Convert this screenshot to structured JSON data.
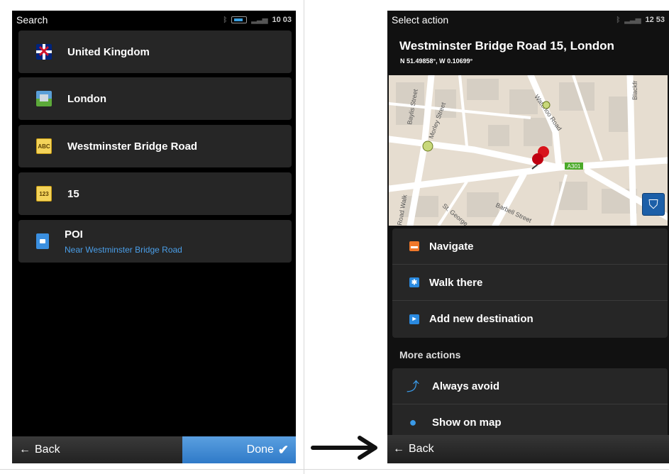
{
  "left_screen": {
    "status": {
      "title": "Search",
      "time": "10 03"
    },
    "items": [
      {
        "icon": "uk-flag-icon",
        "label": "United Kingdom"
      },
      {
        "icon": "city-icon",
        "label": "London"
      },
      {
        "icon": "street-sign-icon",
        "icon_text": "ABC",
        "label": "Westminster Bridge Road"
      },
      {
        "icon": "house-number-icon",
        "icon_text": "123",
        "label": "15"
      },
      {
        "icon": "fuel-icon",
        "label": "POI",
        "sublabel": "Near Westminster Bridge Road"
      }
    ],
    "bottom": {
      "back_label": "Back",
      "done_label": "Done"
    }
  },
  "right_screen": {
    "status": {
      "title": "Select action",
      "time": "12 53"
    },
    "address": "Westminster Bridge Road 15, London",
    "coordinates": "N 51.49858°, W 0.10699°",
    "map": {
      "road_labels": [
        "Baylis Street",
        "Morley Street",
        "Waterloo Road",
        "A301",
        "Barbell Street",
        "St. George",
        "Road Walk",
        "Blackfr"
      ]
    },
    "actions": [
      {
        "icon": "car-icon",
        "label": "Navigate",
        "color": "#f0782a"
      },
      {
        "icon": "walk-icon",
        "label": "Walk there",
        "color": "#2a8ae0"
      },
      {
        "icon": "add-destination-icon",
        "label": "Add new destination",
        "color": "#2a8ae0"
      }
    ],
    "more_actions_header": "More actions",
    "more_actions": [
      {
        "icon": "avoid-arrow-icon",
        "label": "Always avoid"
      },
      {
        "icon": "map-pin-icon",
        "label": "Show on map"
      }
    ],
    "bottom": {
      "back_label": "Back"
    }
  },
  "colors": {
    "accent_blue": "#4a9ee8",
    "done_button": "#3a86d4",
    "panel_bg": "#262626"
  }
}
